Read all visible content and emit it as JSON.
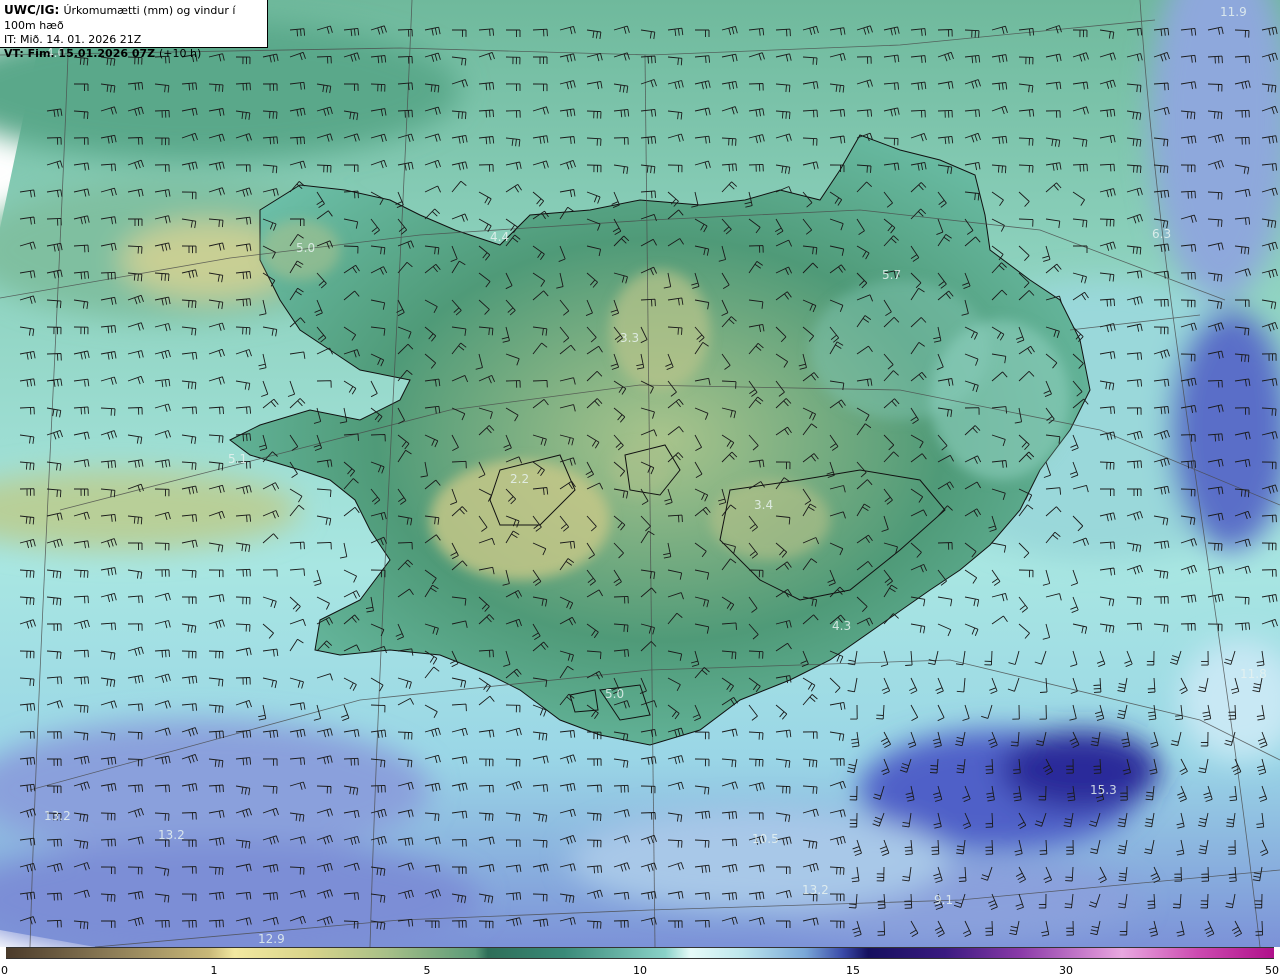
{
  "header": {
    "model": "UWC/IG:",
    "title": "Úrkomumætti (mm) og vindur í 100m hæð",
    "init_time": "IT: Mið. 14. 01. 2026 21Z",
    "valid_prefix": "VT:",
    "valid_time": "Fim. 15.01.2026 07Z",
    "lead": "(+10 h)"
  },
  "labels": [
    "11.9",
    "4.0",
    "5.0",
    "4.4",
    "6.3",
    "5.7",
    "3.3",
    "5.1",
    "2.2",
    "3.4",
    "4.3",
    "5.0",
    "11.8",
    "15.3",
    "13.2",
    "13.2",
    "10.5",
    "13.2",
    "12.9",
    "9.1"
  ],
  "colorbar": {
    "ticks": [
      "0",
      "1",
      "5",
      "10",
      "15",
      "30",
      "50"
    ]
  },
  "colors": {
    "land_low": "#d8d490",
    "land_mid": "#3d8c6e",
    "sea_light": "#bff0ec",
    "sea_blue": "#7c8fd6",
    "sea_deep": "#1c1c8a"
  }
}
